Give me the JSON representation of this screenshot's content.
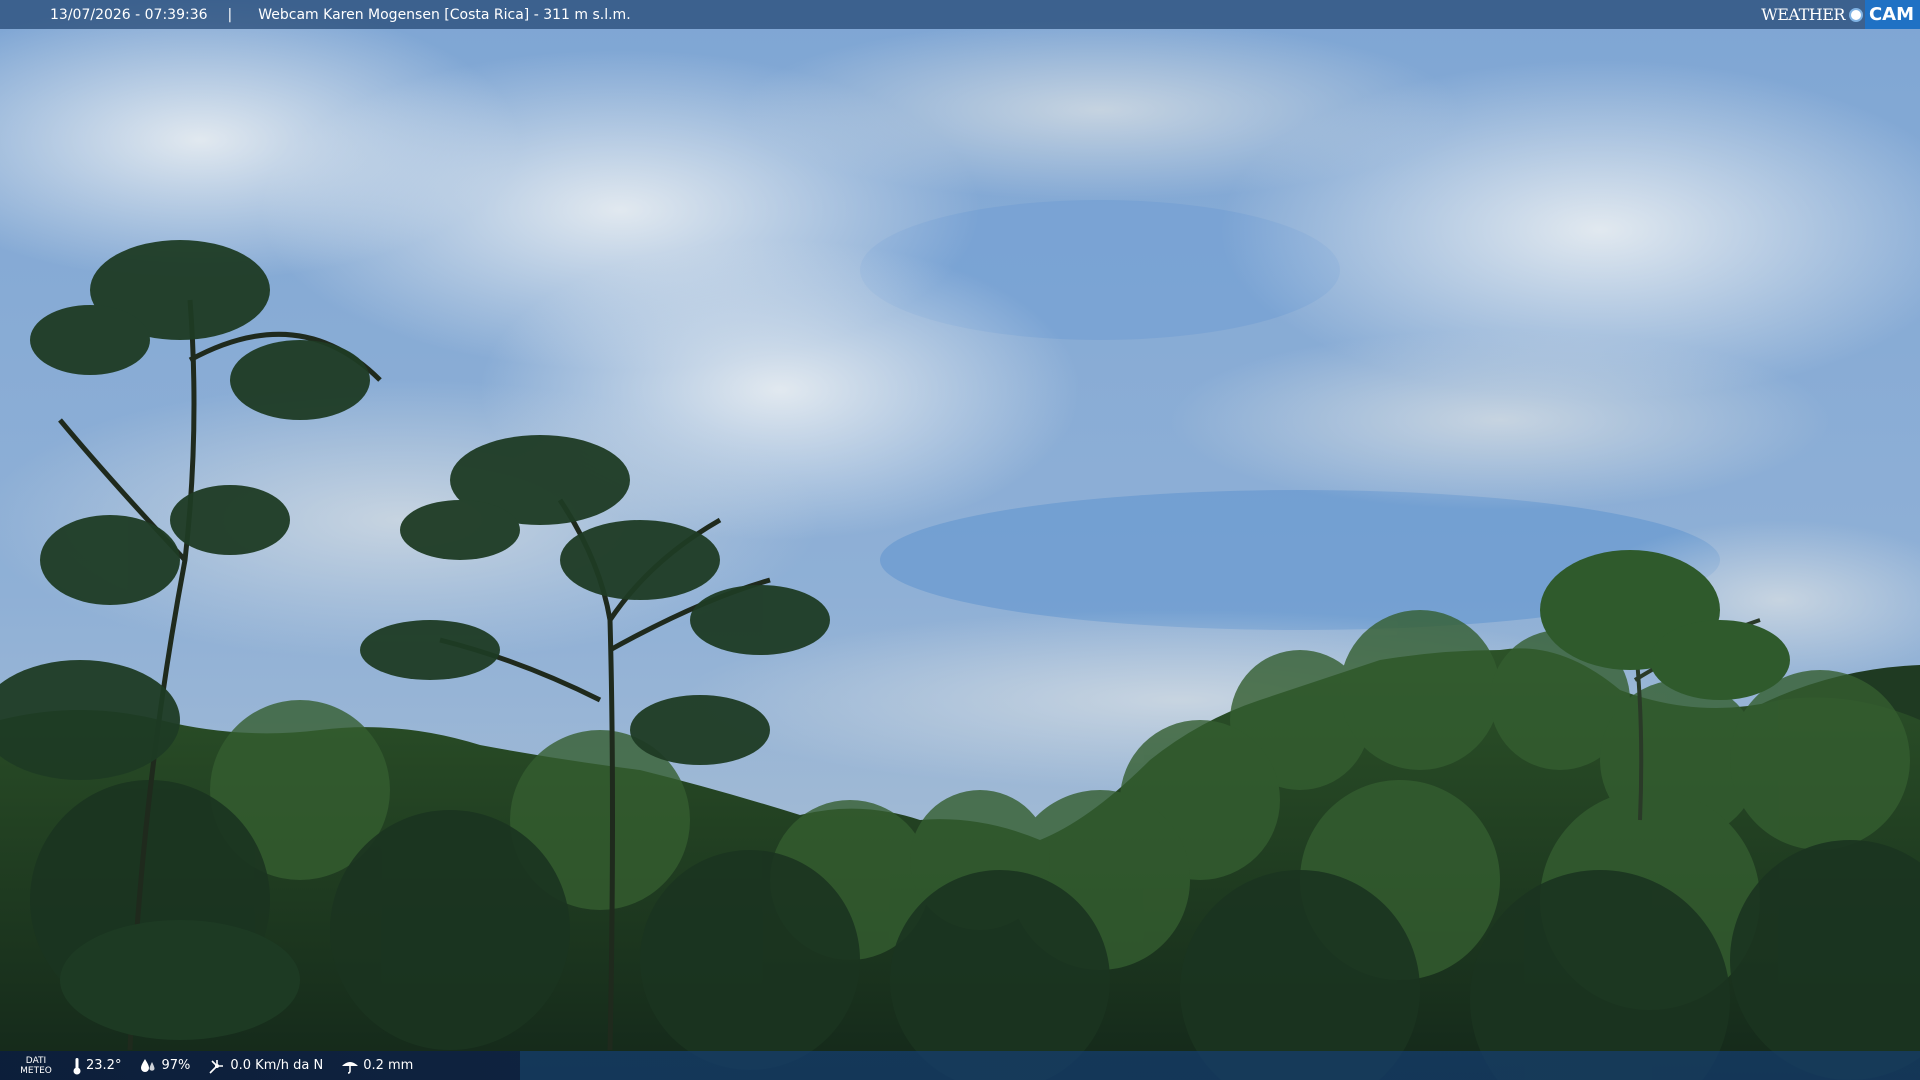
{
  "overlay": {
    "timestamp": "13/07/2026 - 07:39:36",
    "separator": "|",
    "title": "Webcam Karen Mogensen [Costa Rica]  - 311 m s.l.m."
  },
  "brand": {
    "weather": "WEATHER",
    "cam": "CAM"
  },
  "meteo": {
    "label_line1": "DATI",
    "label_line2": "METEO",
    "temperature": "23.2°",
    "humidity": "97%",
    "wind": "0.0 Km/h da N",
    "rain": "0.2 mm"
  },
  "icons": [
    "thermometer-icon",
    "humidity-icon",
    "wind-icon",
    "rain-icon",
    "brand-dot-icon"
  ],
  "colors": {
    "topbar": "#234673",
    "brand_accent": "#1f71c4",
    "sky_top": "#6f9acd",
    "sky_bottom": "#a9c0d6",
    "forest_dark": "#16301a",
    "forest_mid": "#2f5a2c"
  }
}
